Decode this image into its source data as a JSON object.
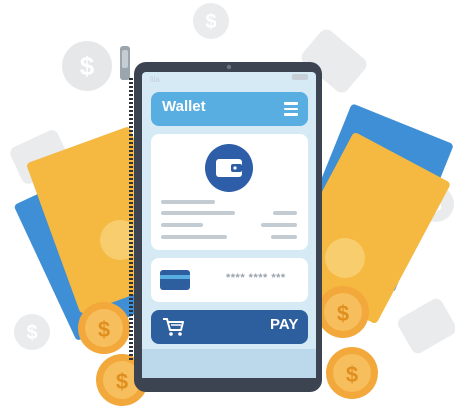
{
  "wallet": {
    "title": "Wallet"
  },
  "card": {
    "masked_number": "**** **** ***"
  },
  "pay": {
    "label": "PAY"
  },
  "status": {
    "left": "lila"
  },
  "icons": {
    "menu": "hamburger-menu-icon",
    "wallet": "wallet-icon",
    "card": "credit-card-icon",
    "cart": "shopping-cart-icon",
    "coin": "dollar-coin-icon"
  },
  "colors": {
    "phone_body": "#3b4450",
    "screen_bg": "#d6eaf6",
    "header_blue": "#58aee0",
    "pay_blue": "#2d5f9e",
    "wallet_icon_bg": "#2f5ea8",
    "money_orange": "#f5b841",
    "money_blue": "#3f8fd6",
    "coin_orange": "#f2a83a"
  }
}
